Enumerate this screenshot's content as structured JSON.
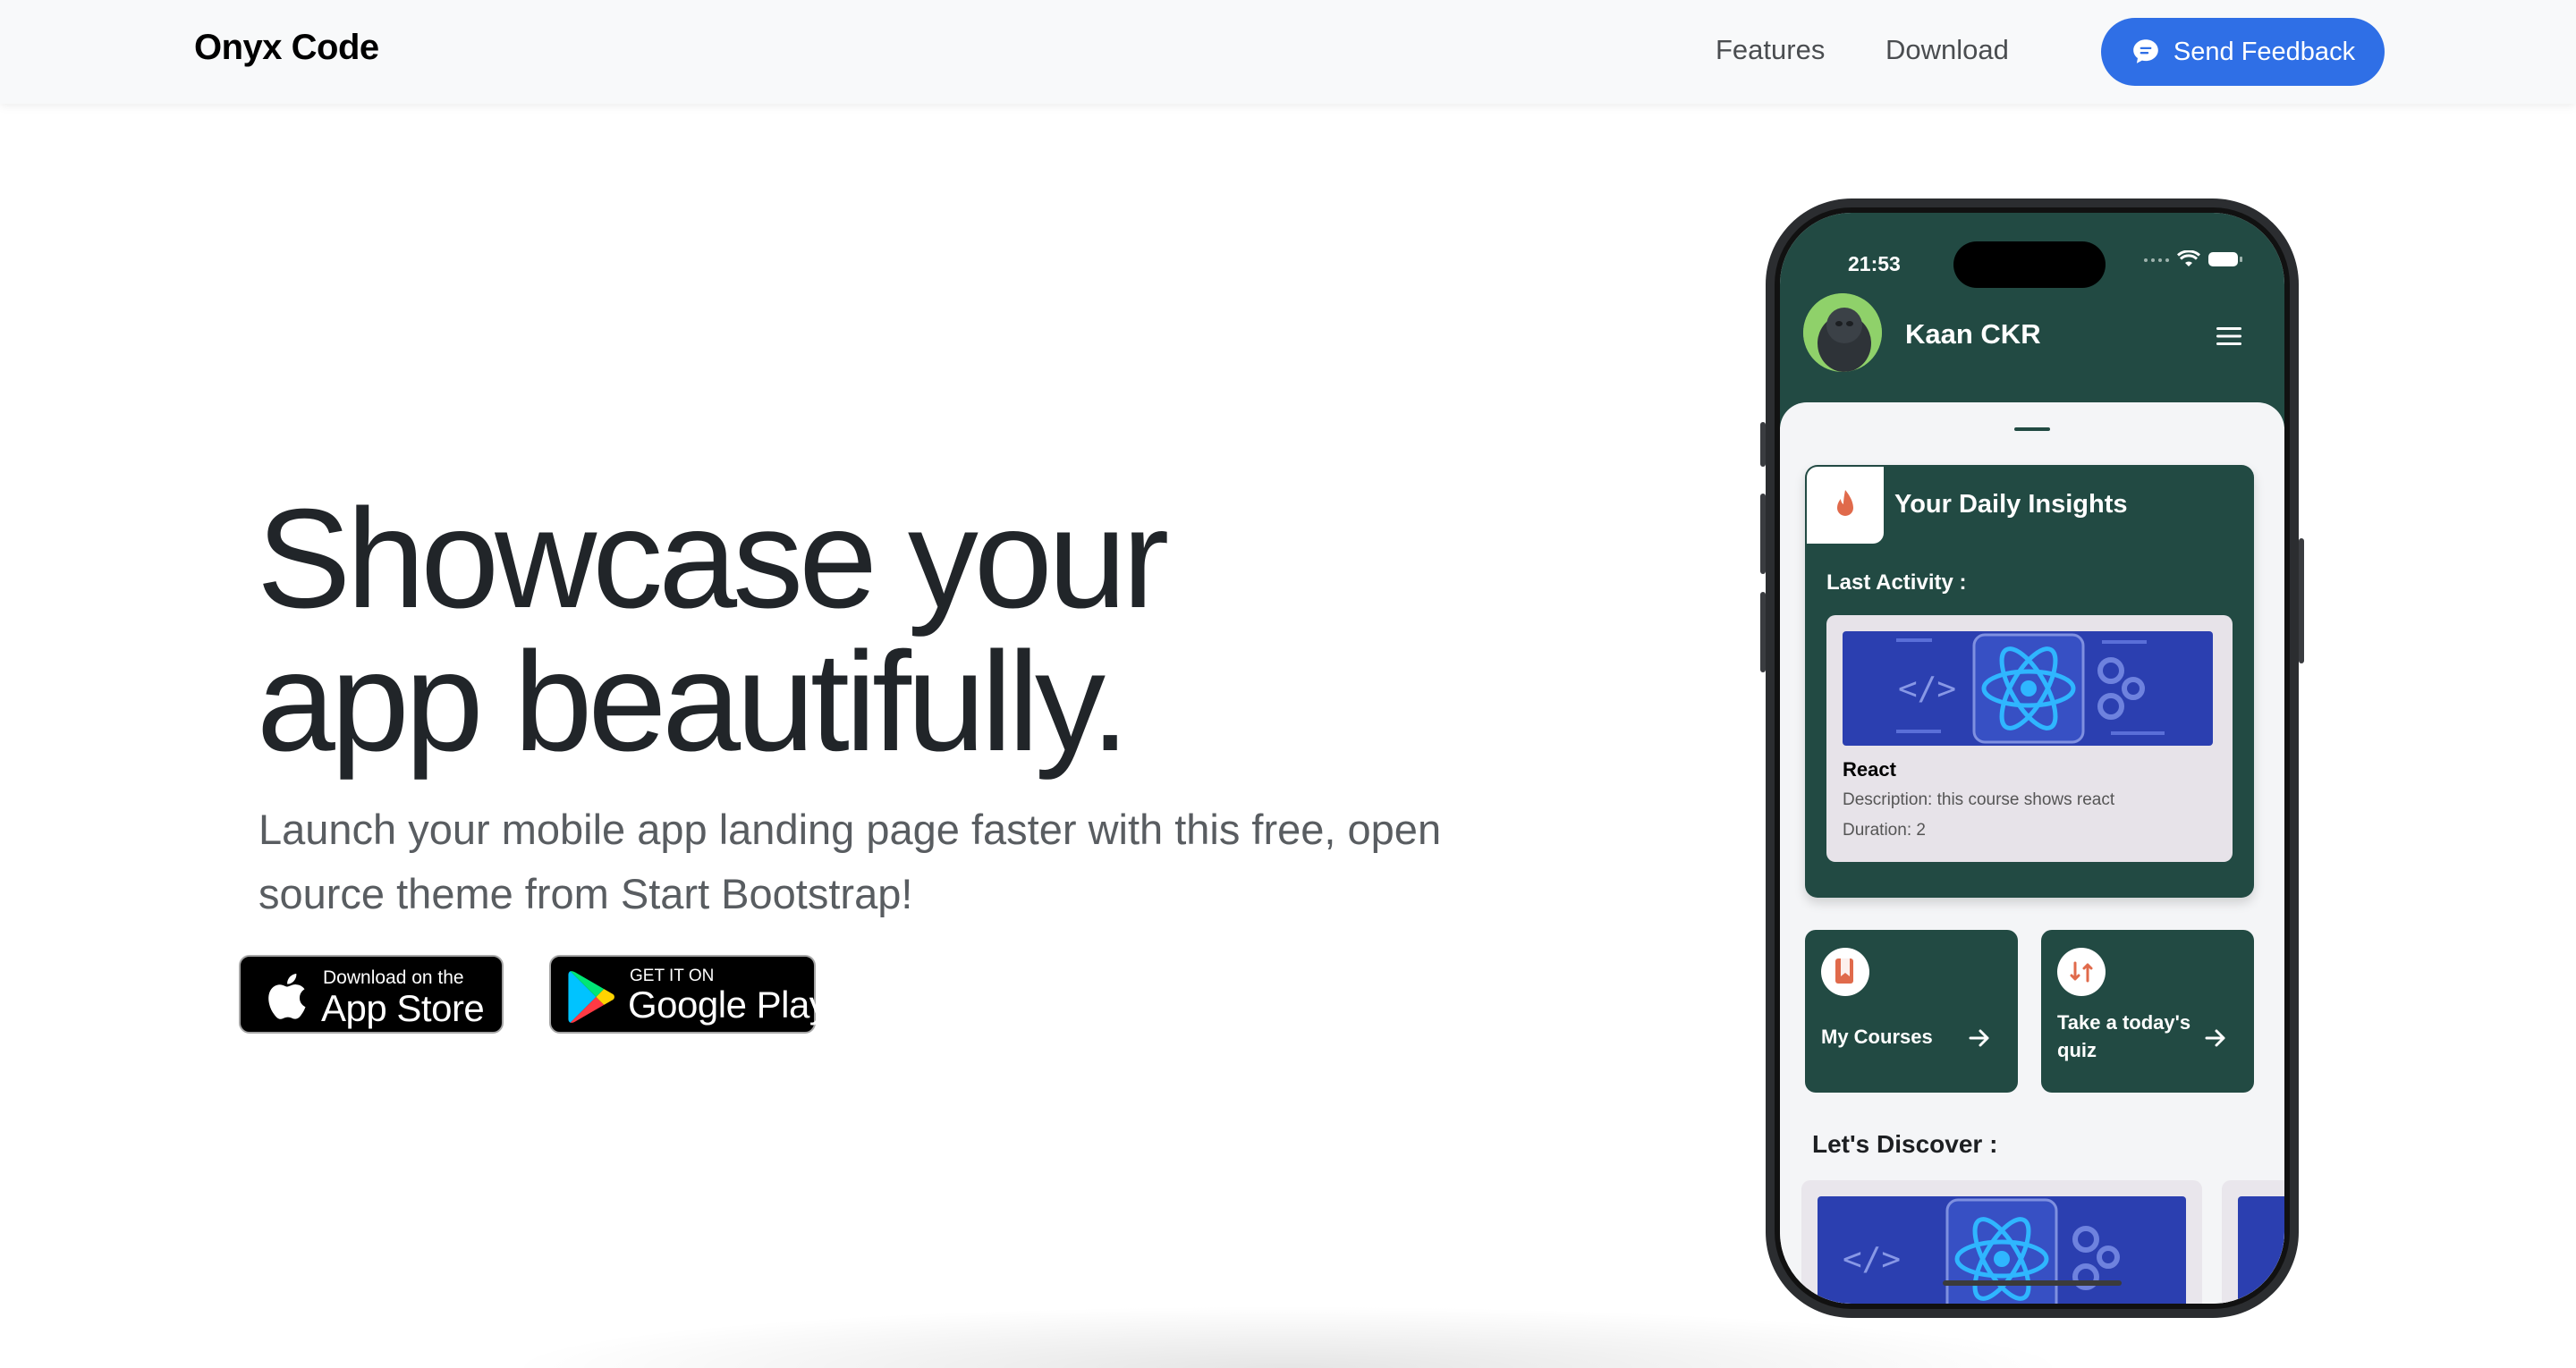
{
  "navbar": {
    "brand": "Onyx Code",
    "links": [
      {
        "label": "Features"
      },
      {
        "label": "Download"
      }
    ],
    "feedback_button": "Send Feedback",
    "feedback_icon": "chat-bubble-icon"
  },
  "hero": {
    "title_line1": "Showcase your",
    "title_line2": "app beautifully.",
    "subtitle": "Launch your mobile app landing page faster with this free, open source theme from Start Bootstrap!",
    "app_store": {
      "small": "Download on the",
      "big": "App Store",
      "icon": "apple-icon"
    },
    "google_play": {
      "small": "GET IT ON",
      "big": "Google Play",
      "icon": "google-play-icon"
    }
  },
  "phone": {
    "time": "21:53",
    "user_name": "Kaan CKR",
    "insights": {
      "title": "Your Daily Insights",
      "icon": "flame-icon",
      "last_activity_label": "Last Activity :",
      "course_name": "React",
      "course_description": "Description: this course shows react",
      "course_duration": "Duration: 2"
    },
    "tiles": [
      {
        "label": "My Courses",
        "icon": "bookmark-icon"
      },
      {
        "label": "Take a today's quiz",
        "icon": "swap-icon"
      }
    ],
    "discover_label": "Let's Discover :"
  },
  "colors": {
    "accent": "#2f6fe6",
    "app_green": "#224a43",
    "text_dark": "#212529",
    "text_muted": "#595d61"
  }
}
